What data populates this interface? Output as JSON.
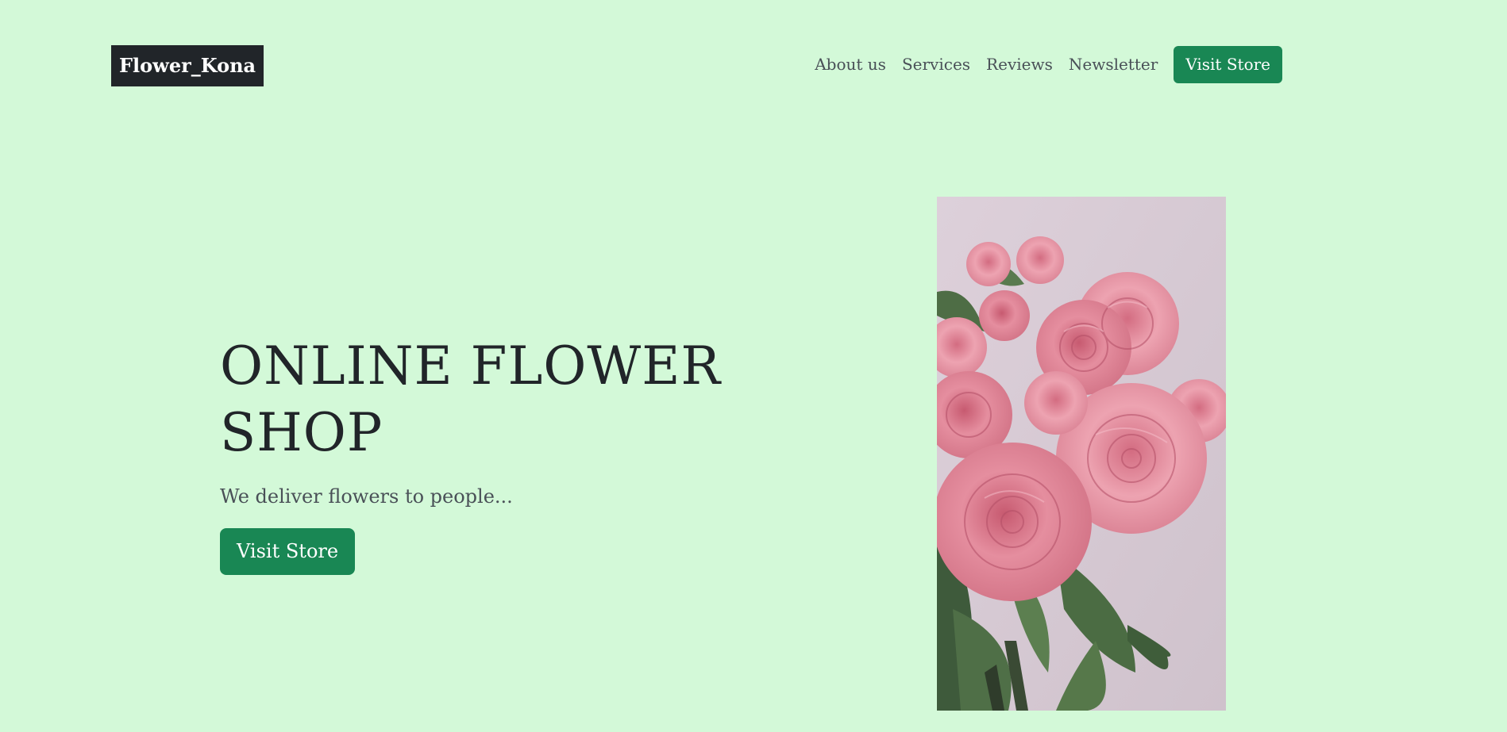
{
  "navbar": {
    "brand": "Flower_Kona",
    "links": [
      {
        "label": "About us"
      },
      {
        "label": "Services"
      },
      {
        "label": "Reviews"
      },
      {
        "label": "Newsletter"
      }
    ],
    "cta_label": "Visit Store"
  },
  "hero": {
    "title": "ONLINE FLOWER SHOP",
    "subtitle": "We deliver flowers to people...",
    "cta_label": "Visit Store",
    "image": "pink-roses-bouquet-photo"
  },
  "colors": {
    "background": "#d3f9d8",
    "brand_bg": "#212529",
    "accent": "#198754",
    "text_muted": "#495057"
  }
}
